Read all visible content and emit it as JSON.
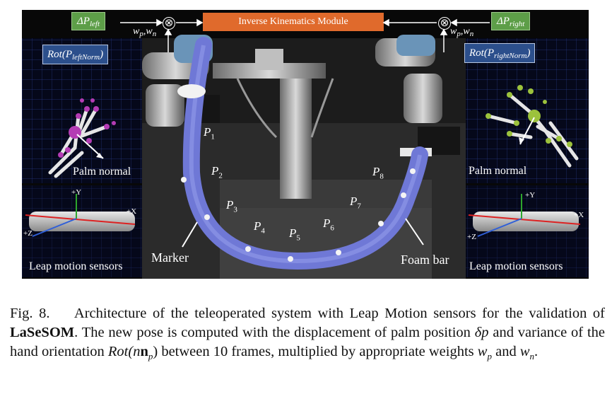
{
  "figure": {
    "delta_left": "ΔP",
    "delta_left_sub": "left",
    "delta_right": "ΔP",
    "delta_right_sub": "right",
    "ik_module": "Inverse Kinematics Module",
    "weights_left": "w",
    "weights_right": "w",
    "rot_left": "Rot(P",
    "rot_left_sub": "leftNorm",
    "rot_right": "Rot(P",
    "rot_right_sub": "rightNorm",
    "otimes": "⊗",
    "palm_normal_left": "Palm normal",
    "palm_normal_right": "Palm normal",
    "leap_left": "Leap motion sensors",
    "leap_right": "Leap motion sensors",
    "marker": "Marker",
    "foam_bar": "Foam bar",
    "axis_y": "+Y",
    "axis_x": "+X",
    "axis_z": "+Z",
    "points": [
      "P1",
      "P2",
      "P3",
      "P4",
      "P5",
      "P6",
      "P7",
      "P8"
    ],
    "colors": {
      "green_box": "#5d9e48",
      "blue_box": "#2c4f8c",
      "orange_box": "#e06a2c",
      "foam": "#6f78d6",
      "hand_left": "#b43cb4",
      "hand_right": "#9cc23c"
    }
  },
  "caption": {
    "fig_label": "Fig. 8.",
    "text_1": "Architecture of the teleoperated system with Leap Motion sensors for the validation of ",
    "bold": "LaSeSOM",
    "text_2": ". The new pose is computed with the displacement of palm position ",
    "math_dp": "δp",
    "text_3": " and variance of the hand orientation ",
    "math_rot": "Rot(n",
    "text_4": " between 10 frames, multiplied by appropriate weights ",
    "math_wp": "w",
    "text_5": " and ",
    "math_wn": "w",
    "text_6": "."
  }
}
